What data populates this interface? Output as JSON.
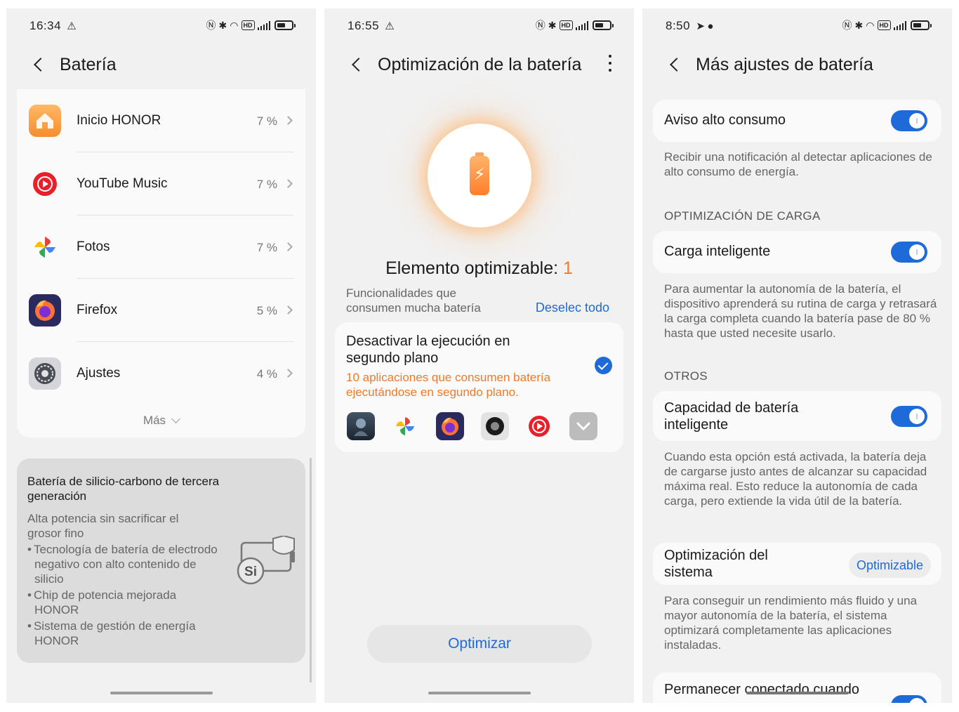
{
  "screen1": {
    "status": {
      "time": "16:34",
      "alert": "⚠"
    },
    "title": "Batería",
    "apps": [
      {
        "name": "Inicio HONOR",
        "pct": "7 %",
        "color": "#f7a24a"
      },
      {
        "name": "YouTube Music",
        "pct": "7 %",
        "color": "#ffffff"
      },
      {
        "name": "Fotos",
        "pct": "7 %",
        "color": "#ffffff"
      },
      {
        "name": "Firefox",
        "pct": "5 %",
        "color": "#2b2a5e"
      },
      {
        "name": "Ajustes",
        "pct": "4 %",
        "color": "#d4d6dc"
      }
    ],
    "more": "Más",
    "promo": {
      "title": "Batería de silicio-carbono de tercera generación",
      "subtitle": "Alta potencia sin sacrificar el grosor fino",
      "bullets": [
        "Tecnología de batería de electrodo negativo con alto contenido de silicio",
        "Chip de potencia mejorada HONOR",
        "Sistema de gestión de energía HONOR"
      ],
      "badge": "Si"
    }
  },
  "screen2": {
    "status": {
      "time": "16:55",
      "alert": "⚠"
    },
    "title": "Optimización de la batería",
    "optim_label": "Elemento optimizable:",
    "optim_count": "1",
    "func_label": "Funcionalidades que consumen mucha batería",
    "deselect": "Deselec todo",
    "card_title": "Desactivar la ejecución en segundo plano",
    "card_desc": "10 aplicaciones que consumen batería ejecutándose en segundo plano.",
    "mini_apps": [
      "Destiny Rising",
      "Fotos",
      "Firefox",
      "Cámara",
      "YouTube Music",
      "Expandir"
    ],
    "button": "Optimizar",
    "accent": "#1e6ad8",
    "warning_color": "#f07a2a"
  },
  "screen3": {
    "status": {
      "time": "8:50"
    },
    "title": "Más ajustes de batería",
    "high_use": {
      "title": "Aviso alto consumo",
      "desc": "Recibir una notificación al detectar aplicaciones de alto consumo de energía.",
      "on": true
    },
    "section_charge": "OPTIMIZACIÓN DE CARGA",
    "smart_charge": {
      "title": "Carga inteligente",
      "desc": "Para aumentar la autonomía de la batería, el dispositivo aprenderá su rutina de carga y retrasará la carga completa cuando la batería pase de 80 % hasta que usted necesite usarlo.",
      "on": true
    },
    "section_other": "OTROS",
    "smart_capacity": {
      "title": "Capacidad de batería inteligente",
      "desc": "Cuando esta opción está activada, la batería deja de cargarse justo antes de alcanzar su capacidad máxima real. Esto reduce la autonomía de cada carga, pero extiende la vida útil de la batería.",
      "on": true
    },
    "sys_opt": {
      "title": "Optimización del sistema",
      "status": "Optimizable",
      "desc": "Para conseguir un rendimiento más fluido y una mayor autonomía de la batería, el sistema optimizará completamente las aplicaciones instaladas."
    },
    "stay_connected": {
      "title": "Permanecer conectado cuando",
      "on": true
    }
  }
}
